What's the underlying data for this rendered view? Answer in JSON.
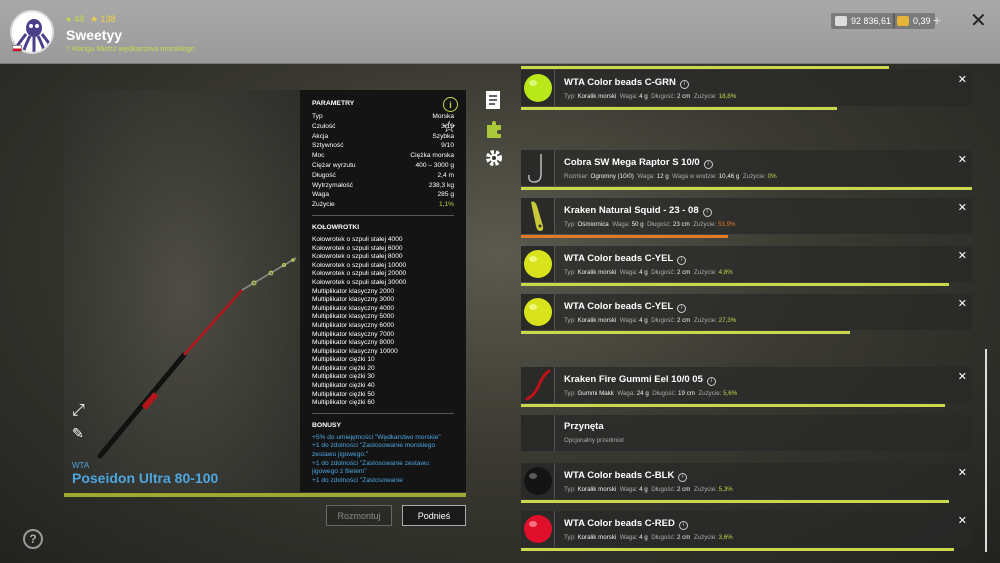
{
  "player": {
    "level": "48",
    "stars": "138",
    "name": "Sweetyy",
    "rank": "7 Ranga Mistrz wędkarstwa morskiego"
  },
  "currency": {
    "silver": "92 836,61",
    "gold": "0,39"
  },
  "item": {
    "brand": "WTA",
    "name": "Poseidon Ultra 80-100",
    "params_title": "PARAMETRY",
    "params": [
      {
        "label": "Typ",
        "value": "Morska"
      },
      {
        "label": "Czułość",
        "value": "3/10"
      },
      {
        "label": "Akcja",
        "value": "Szybka"
      },
      {
        "label": "Sztywność",
        "value": "9/10"
      },
      {
        "label": "Moc",
        "value": "Ciężka morska"
      },
      {
        "label": "Ciężar wyrzutu",
        "value": "400 – 3000 g"
      },
      {
        "label": "Długość",
        "value": "2,4 m"
      },
      {
        "label": "Wytrzymałość",
        "value": "238,3 kg"
      },
      {
        "label": "Waga",
        "value": "285 g"
      },
      {
        "label": "Zużycie",
        "value": "1,1%"
      }
    ],
    "reels_title": "KOŁOWROTKI",
    "reels": [
      "Kołowrotek o szpuli stałej 4000",
      "Kołowrotek o szpuli stałej 6000",
      "Kołowrotek o szpuli stałej 8000",
      "Kołowrotek o szpuli stałej 10000",
      "Kołowrotek o szpuli stałej 20000",
      "Kołowrotek o szpuli stałej 30000",
      "Multiplikator klasyczny 2000",
      "Multiplikator klasyczny 3000",
      "Multiplikator klasyczny 4000",
      "Multiplikator klasyczny 5000",
      "Multiplikator klasyczny 6000",
      "Multiplikator klasyczny 7000",
      "Multiplikator klasyczny 8000",
      "Multiplikator klasyczny 10000",
      "Multiplikator ciężki 10",
      "Multiplikator ciężki 20",
      "Multiplikator ciężki 30",
      "Multiplikator ciężki 40",
      "Multiplikator ciężki 50",
      "Multiplikator ciężki 60"
    ],
    "bonus_title": "BONUSY",
    "bonuses": [
      "+5% do umiejętności \"Wędkarstwo morskie\"",
      "+1 do zdolności \"Zastosowanie morskiego zestawu jigowego.\"",
      "+1 do zdolności \"Zastosowanie zestawu jigowego z filetem\"",
      "+1 do zdolności \"Zastosowanie"
    ]
  },
  "buttons": {
    "disassemble": "Rozmontuj",
    "pick_up": "Podnieś"
  },
  "slots": [
    {
      "title": "WTA Color beads C-GRN",
      "type_label": "Typ:",
      "type": "Koralik morski",
      "weight_label": "Waga:",
      "weight": "4 g",
      "length_label": "Długość:",
      "length": "2 cm",
      "wear_label": "Zużycie:",
      "wear": "18,8%",
      "wear_fraction": 0.7,
      "thumb": "green-bead"
    },
    {
      "title": "Cobra SW Mega Raptor S 10/0",
      "size_label": "Rozmiar:",
      "size": "Ogromny (10/0)",
      "weight_label": "Waga:",
      "weight": "12 g",
      "wweight_label": "Waga w wodzie:",
      "wweight": "10,46 g",
      "wear_label": "Zużycie:",
      "wear": "0%",
      "wear_fraction": 1.0,
      "thumb": "hook"
    },
    {
      "title": "Kraken Natural Squid - 23 - 08",
      "type_label": "Typ:",
      "type": "Ośmiornica",
      "weight_label": "Waga:",
      "weight": "50 g",
      "length_label": "Długość:",
      "length": "23 cm",
      "wear_label": "Zużycie:",
      "wear": "53,9%",
      "wear_fraction": 0.46,
      "thumb": "squid"
    },
    {
      "title": "WTA Color beads C-YEL",
      "type_label": "Typ:",
      "type": "Koralik morski",
      "weight_label": "Waga:",
      "weight": "4 g",
      "length_label": "Długość:",
      "length": "2 cm",
      "wear_label": "Zużycie:",
      "wear": "4,8%",
      "wear_fraction": 0.95,
      "thumb": "yellow-bead"
    },
    {
      "title": "WTA Color beads C-YEL",
      "type_label": "Typ:",
      "type": "Koralik morski",
      "weight_label": "Waga:",
      "weight": "4 g",
      "length_label": "Długość:",
      "length": "2 cm",
      "wear_label": "Zużycie:",
      "wear": "27,3%",
      "wear_fraction": 0.73,
      "thumb": "yellow-bead"
    },
    {
      "title": "Kraken Fire Gummi Eel 10/0 05",
      "type_label": "Typ:",
      "type": "Gummi Makk",
      "weight_label": "Waga:",
      "weight": "24 g",
      "length_label": "Długość:",
      "length": "19 cm",
      "wear_label": "Zużycie:",
      "wear": "5,6%",
      "wear_fraction": 0.94,
      "thumb": "eel"
    },
    {
      "title": "Przynęta",
      "subtitle": "Opcjonalny przedmiot",
      "thumb": "empty"
    },
    {
      "title": "WTA Color beads C-BLK",
      "type_label": "Typ:",
      "type": "Koralik morski",
      "weight_label": "Waga:",
      "weight": "4 g",
      "length_label": "Długość:",
      "length": "2 cm",
      "wear_label": "Zużycie:",
      "wear": "5,3%",
      "wear_fraction": 0.95,
      "thumb": "black-bead"
    },
    {
      "title": "WTA Color beads C-RED",
      "type_label": "Typ:",
      "type": "Koralik morski",
      "weight_label": "Waga:",
      "weight": "4 g",
      "length_label": "Długość:",
      "length": "2 cm",
      "wear_label": "Zużycie:",
      "wear": "3,6%",
      "wear_fraction": 0.96,
      "thumb": "red-bead"
    }
  ]
}
